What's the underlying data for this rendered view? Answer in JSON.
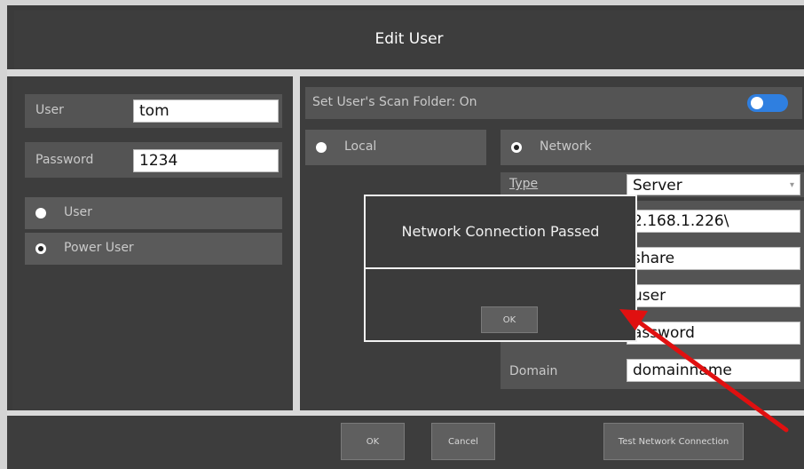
{
  "header": {
    "title": "Edit User"
  },
  "left": {
    "user_label": "User",
    "user_value": "tom",
    "password_label": "Password",
    "password_value": "1234",
    "roles": [
      {
        "label": "User",
        "selected": false
      },
      {
        "label": "Power User",
        "selected": true
      }
    ]
  },
  "right": {
    "scan_folder_label": "Set User's Scan Folder: On",
    "scan_folder_on": true,
    "local_label": "Local",
    "network_label": "Network",
    "network_selected": true,
    "fields": {
      "type_label": "Type",
      "type_value": "Server",
      "path_value": "2.168.1.226\\",
      "share_value": "share",
      "user_value": "user",
      "password_value": "assword",
      "domain_label": "Domain",
      "domain_value": "domainname"
    }
  },
  "dialog": {
    "message": "Network Connection Passed",
    "ok_label": "OK"
  },
  "footer": {
    "ok_label": "OK",
    "cancel_label": "Cancel",
    "test_label": "Test Network Connection"
  },
  "colors": {
    "panel": "#3d3d3d",
    "toggle_on": "#2f7fe0",
    "arrow": "#e01010"
  }
}
